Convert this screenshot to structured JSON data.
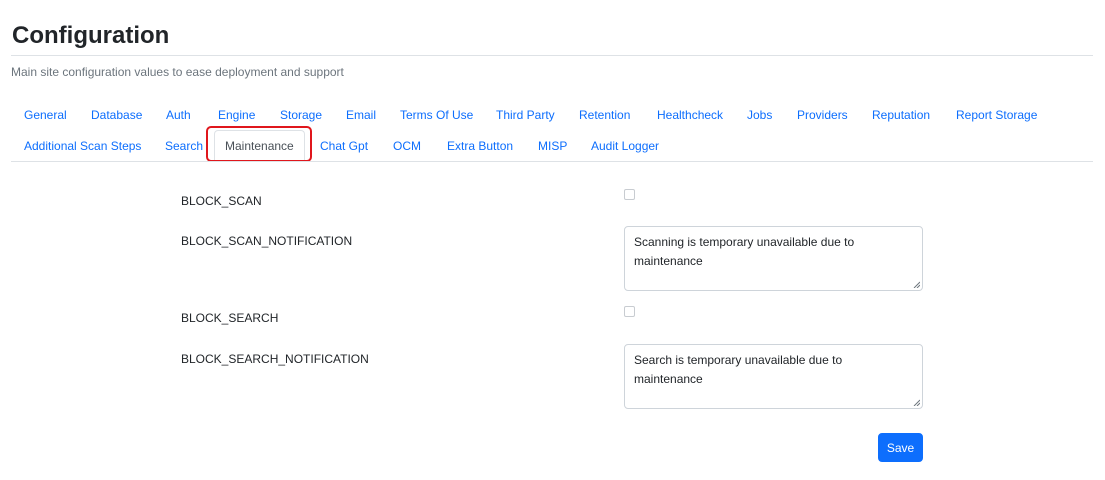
{
  "page": {
    "title": "Configuration",
    "subtitle": "Main site configuration values to ease deployment and support"
  },
  "tabs": [
    {
      "label": "General",
      "active": false
    },
    {
      "label": "Database",
      "active": false
    },
    {
      "label": "Auth",
      "active": false
    },
    {
      "label": "Engine",
      "active": false
    },
    {
      "label": "Storage",
      "active": false
    },
    {
      "label": "Email",
      "active": false
    },
    {
      "label": "Terms Of Use",
      "active": false
    },
    {
      "label": "Third Party",
      "active": false
    },
    {
      "label": "Retention",
      "active": false
    },
    {
      "label": "Healthcheck",
      "active": false
    },
    {
      "label": "Jobs",
      "active": false
    },
    {
      "label": "Providers",
      "active": false
    },
    {
      "label": "Reputation",
      "active": false
    },
    {
      "label": "Report Storage",
      "active": false
    },
    {
      "label": "Additional Scan Steps",
      "active": false
    },
    {
      "label": "Search",
      "active": false
    },
    {
      "label": "Maintenance",
      "active": true
    },
    {
      "label": "Chat Gpt",
      "active": false
    },
    {
      "label": "OCM",
      "active": false
    },
    {
      "label": "Extra Button",
      "active": false
    },
    {
      "label": "MISP",
      "active": false
    },
    {
      "label": "Audit Logger",
      "active": false
    }
  ],
  "maintenance": {
    "block_scan": {
      "label": "BLOCK_SCAN",
      "checked": false
    },
    "block_scan_notification": {
      "label": "BLOCK_SCAN_NOTIFICATION",
      "value": "Scanning is temporary unavailable due to maintenance"
    },
    "block_search": {
      "label": "BLOCK_SEARCH",
      "checked": false
    },
    "block_search_notification": {
      "label": "BLOCK_SEARCH_NOTIFICATION",
      "value": "Search is temporary unavailable due to maintenance"
    },
    "save_label": "Save"
  },
  "colors": {
    "link": "#0d6efd",
    "primary_button": "#0d6efd",
    "highlight_outline": "#e0161c"
  }
}
